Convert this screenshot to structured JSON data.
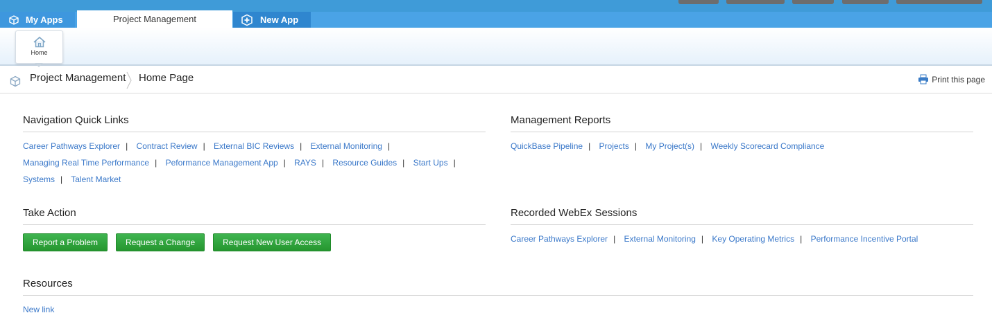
{
  "tabs": {
    "my_apps": "My Apps",
    "project_management": "Project Management",
    "new_app": "New App"
  },
  "ribbon": {
    "home_label": "Home"
  },
  "breadcrumb": {
    "app": "Project Management",
    "page": "Home Page",
    "print": "Print this page"
  },
  "nav_quick_links": {
    "title": "Navigation Quick Links",
    "items": [
      "Career Pathways Explorer",
      "Contract Review",
      "External BIC Reviews",
      "External Monitoring",
      "Managing Real Time Performance",
      "Peformance Management App",
      "RAYS",
      "Resource Guides",
      "Start Ups",
      "Systems",
      "Talent Market"
    ]
  },
  "management_reports": {
    "title": "Management Reports",
    "items": [
      "QuickBase Pipeline",
      "Projects",
      "My Project(s)",
      "Weekly Scorecard Compliance"
    ]
  },
  "take_action": {
    "title": "Take Action",
    "buttons": [
      "Report a Problem",
      "Request a Change",
      "Request New User Access"
    ]
  },
  "webex": {
    "title": "Recorded WebEx Sessions",
    "items": [
      "Career Pathways Explorer",
      "External Monitoring",
      "Key Operating Metrics",
      "Performance Incentive Portal"
    ]
  },
  "resources": {
    "title": "Resources",
    "items": [
      "New link"
    ]
  },
  "colors": {
    "link": "#3a78c9",
    "tab_blue": "#4aa3e6",
    "button_green": "#2da43a"
  },
  "separator": "|"
}
